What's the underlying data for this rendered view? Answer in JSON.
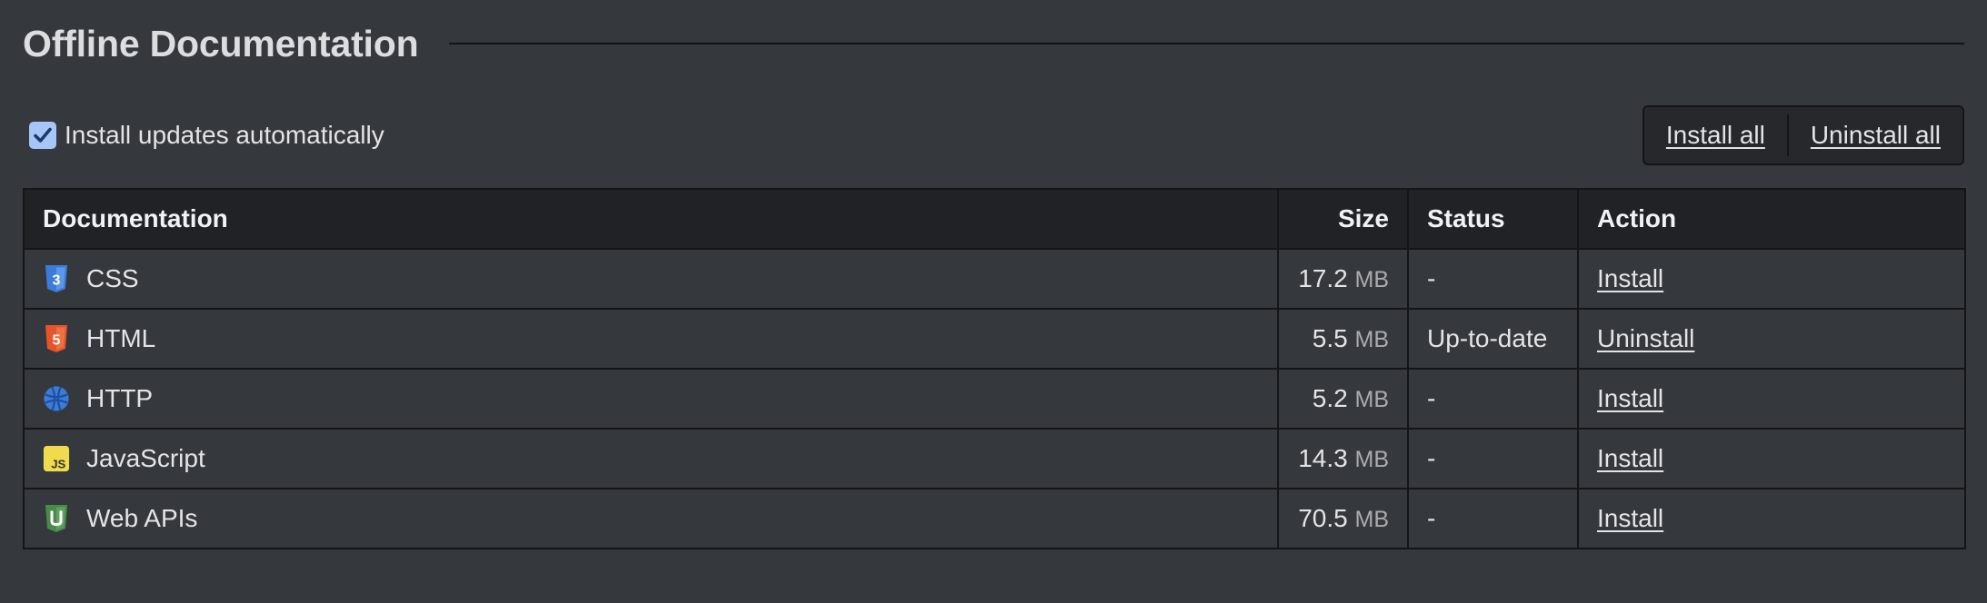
{
  "section": {
    "title": "Offline Documentation"
  },
  "settings": {
    "auto_update_label": "Install updates automatically",
    "auto_update_checked": true
  },
  "bulk_actions": {
    "install_all": "Install all",
    "uninstall_all": "Uninstall all"
  },
  "table": {
    "headers": {
      "documentation": "Documentation",
      "size": "Size",
      "status": "Status",
      "action": "Action"
    },
    "rows": [
      {
        "name": "CSS",
        "icon": "css3-icon",
        "size": "17.2",
        "unit": "MB",
        "status": "-",
        "action": "Install"
      },
      {
        "name": "HTML",
        "icon": "html5-icon",
        "size": "5.5",
        "unit": "MB",
        "status": "Up-to-date",
        "action": "Uninstall"
      },
      {
        "name": "HTTP",
        "icon": "globe-icon",
        "size": "5.2",
        "unit": "MB",
        "status": "-",
        "action": "Install"
      },
      {
        "name": "JavaScript",
        "icon": "javascript-icon",
        "size": "14.3",
        "unit": "MB",
        "status": "-",
        "action": "Install"
      },
      {
        "name": "Web APIs",
        "icon": "web-apis-icon",
        "size": "70.5",
        "unit": "MB",
        "status": "-",
        "action": "Install"
      }
    ]
  },
  "colors": {
    "background": "#35383c",
    "header_background": "#202225",
    "border": "#141517",
    "checkbox_accent": "#a7c6f7",
    "css_icon": "#3d7bd8",
    "html_icon": "#e5542a",
    "http_icon": "#3d7bd8",
    "javascript_icon": "#f0db4f",
    "web_apis_icon": "#4a8a4a"
  }
}
